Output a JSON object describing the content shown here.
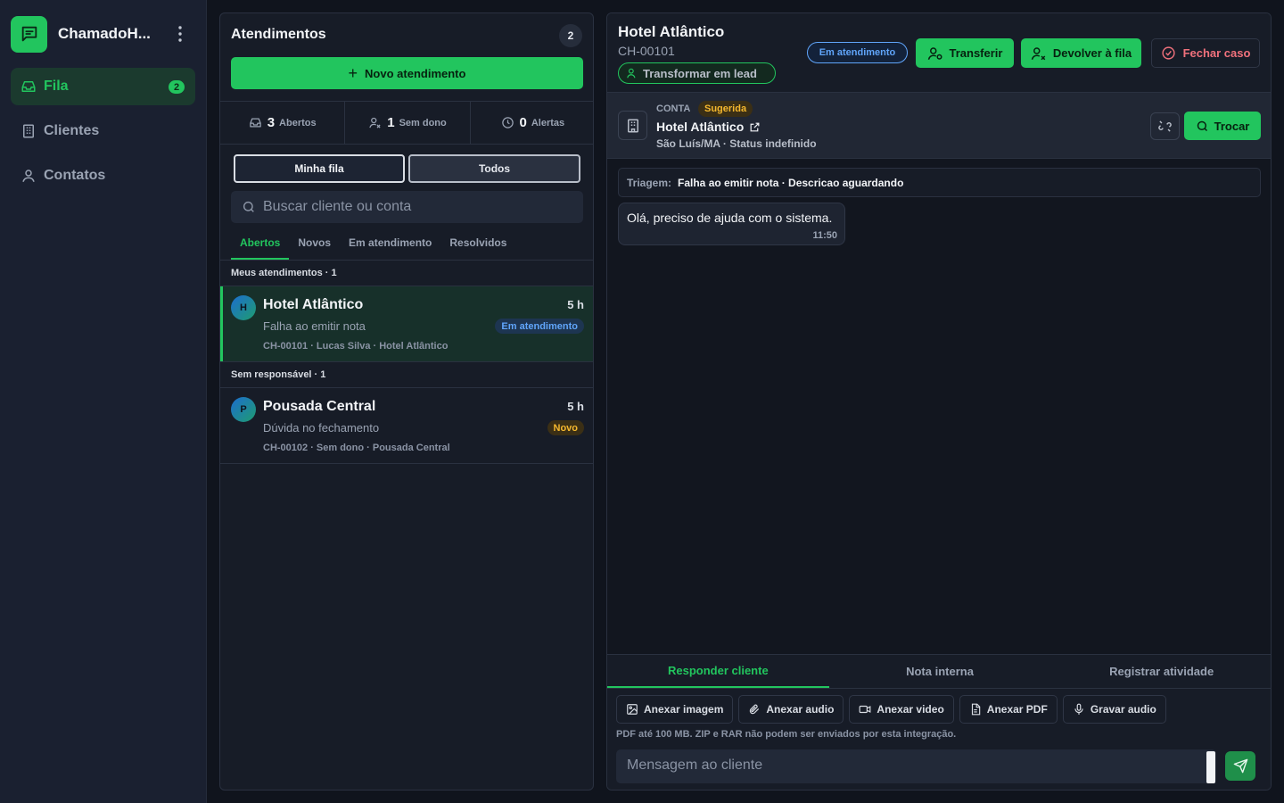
{
  "app": {
    "name": "ChamadoH...",
    "accent": "#22c55e"
  },
  "sidebar": {
    "items": [
      {
        "label": "Fila",
        "icon": "inbox-icon",
        "badge": "2",
        "active": true
      },
      {
        "label": "Clientes",
        "icon": "building-icon"
      },
      {
        "label": "Contatos",
        "icon": "user-icon"
      }
    ]
  },
  "queue": {
    "title": "Atendimentos",
    "count": "2",
    "new_button": "Novo atendimento",
    "stats": [
      {
        "value": "3",
        "label": "Abertos",
        "icon": "inbox-icon"
      },
      {
        "value": "1",
        "label": "Sem dono",
        "icon": "user-off-icon"
      },
      {
        "value": "0",
        "label": "Alertas",
        "icon": "clock-icon"
      }
    ],
    "segments": [
      "Minha fila",
      "Todos"
    ],
    "search_placeholder": "Buscar cliente ou conta",
    "filter_tabs": [
      "Abertos",
      "Novos",
      "Em atendimento",
      "Resolvidos"
    ],
    "active_filter": "Abertos",
    "groups": [
      {
        "label": "Meus atendimentos · 1",
        "tickets": [
          {
            "initial": "H",
            "name": "Hotel Atlântico",
            "time": "5 h",
            "subject": "Falha ao emitir nota",
            "status": "Em atendimento",
            "meta": "CH-00101 · Lucas Silva · Hotel Atlântico",
            "selected": true
          }
        ]
      },
      {
        "label": "Sem responsável · 1",
        "tickets": [
          {
            "initial": "P",
            "name": "Pousada Central",
            "time": "5 h",
            "subject": "Dúvida no fechamento",
            "status": "Novo",
            "meta": "CH-00102 · Sem dono · Pousada Central",
            "selected": false
          }
        ]
      }
    ]
  },
  "detail": {
    "title": "Hotel Atlântico",
    "id": "CH-00101",
    "lead_button": "Transformar em lead",
    "status": "Em atendimento",
    "actions": {
      "transfer": "Transferir",
      "return_queue": "Devolver à fila",
      "close": "Fechar caso"
    },
    "account": {
      "label": "CONTA",
      "tag": "Sugerida",
      "name": "Hotel Atlântico",
      "location": "São Luís/MA · Status indefinido",
      "swap_button": "Trocar"
    },
    "triage": {
      "key": "Triagem:",
      "value": "Falha ao emitir nota · Descricao aguardando"
    },
    "messages": [
      {
        "text": "Olá, preciso de ajuda com o sistema.",
        "time": "11:50"
      }
    ],
    "compose": {
      "tabs": [
        "Responder cliente",
        "Nota interna",
        "Registrar atividade"
      ],
      "active_tab": "Responder cliente",
      "attachments": [
        {
          "label": "Anexar imagem",
          "icon": "image-icon"
        },
        {
          "label": "Anexar audio",
          "icon": "paperclip-icon"
        },
        {
          "label": "Anexar video",
          "icon": "video-icon"
        },
        {
          "label": "Anexar PDF",
          "icon": "file-icon"
        },
        {
          "label": "Gravar audio",
          "icon": "mic-icon"
        }
      ],
      "note": "PDF até 100 MB. ZIP e RAR não podem ser enviados por esta integração.",
      "placeholder": "Mensagem ao cliente"
    }
  }
}
